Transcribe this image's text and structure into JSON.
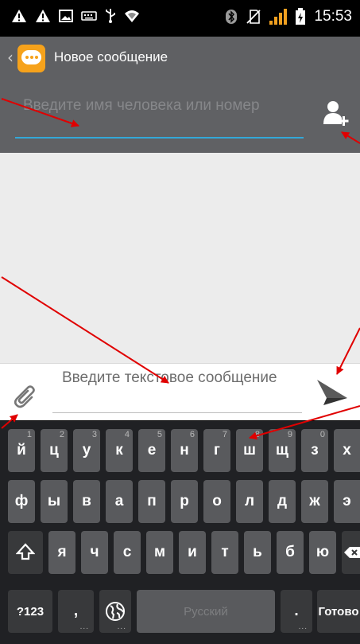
{
  "status_bar": {
    "time": "15:53",
    "icons": [
      "warning-icon",
      "warning-icon",
      "image-icon",
      "keyboard-icon",
      "usb-icon",
      "wifi-icon",
      "bluetooth-icon",
      "no-sim-icon",
      "signal-icon",
      "battery-charging-icon"
    ]
  },
  "action_bar": {
    "title": "Новое сообщение",
    "app_icon": "messaging-app-icon",
    "up_icon": "back-chevron-icon"
  },
  "recipient": {
    "placeholder": "Введите имя человека или номер",
    "add_icon": "add-contact-icon"
  },
  "compose": {
    "placeholder": "Введите текстовое сообщение",
    "attach_icon": "paperclip-icon",
    "send_icon": "send-icon"
  },
  "keyboard": {
    "row1": [
      {
        "label": "й",
        "hint": "1"
      },
      {
        "label": "ц",
        "hint": "2"
      },
      {
        "label": "у",
        "hint": "3"
      },
      {
        "label": "к",
        "hint": "4"
      },
      {
        "label": "е",
        "hint": "5"
      },
      {
        "label": "н",
        "hint": "6"
      },
      {
        "label": "г",
        "hint": "7"
      },
      {
        "label": "ш",
        "hint": "8"
      },
      {
        "label": "щ",
        "hint": "9"
      },
      {
        "label": "з",
        "hint": "0"
      },
      {
        "label": "х",
        "hint": ""
      }
    ],
    "row2": [
      "ф",
      "ы",
      "в",
      "а",
      "п",
      "р",
      "о",
      "л",
      "д",
      "ж",
      "э"
    ],
    "row3": [
      "я",
      "ч",
      "с",
      "м",
      "и",
      "т",
      "ь",
      "б",
      "ю"
    ],
    "symbols_label": "?123",
    "comma_label": ",",
    "space_label": "Русский",
    "period_label": ".",
    "done_label": "Готово",
    "shift_icon": "shift-icon",
    "backspace_icon": "backspace-icon",
    "language_icon": "globe-icon"
  },
  "colors": {
    "action_bar": "#5f6063",
    "accent": "#33a8d8",
    "app_icon": "#f6a21b",
    "arrow": "#e00000",
    "key": "#595a5d",
    "keyboard_bg": "#202124"
  }
}
